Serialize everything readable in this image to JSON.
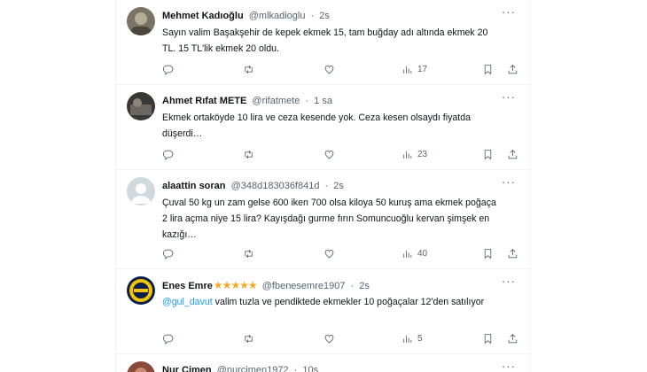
{
  "icons": {
    "more": "more-dots-icon",
    "reply": "reply-icon",
    "retweet": "retweet-icon",
    "like": "heart-icon",
    "views": "views-chart-icon",
    "bookmark": "bookmark-icon",
    "share": "share-icon"
  },
  "colors": {
    "text": "#0f1419",
    "secondary": "#536471",
    "link": "#1d9bf0",
    "star": "#f5a623"
  },
  "more_label": "···",
  "tweets": [
    {
      "name": "Mehmet Kadıoğlu",
      "handle": "@mlkadioglu",
      "sep": "·",
      "time": "2s",
      "text": "Sayın valim Başakşehir de kepek ekmek 15, tam buğday adı altında ekmek 20 TL. 15 TL'lik ekmek 20 oldu.",
      "views": "17"
    },
    {
      "name": "Ahmet Rıfat METE",
      "handle": "@rifatmete",
      "sep": "·",
      "time": "1 sa",
      "text": "Ekmek ortaköyde 10 lira ve ceza kesende yok. Ceza kesen olsaydı fiyatda düşerdi…",
      "views": "23"
    },
    {
      "name": "alaattin soran",
      "handle": "@348d183036f841d",
      "sep": "·",
      "time": "2s",
      "text": "Çuval 50 kg un zam gelse 600 iken 700 olsa kiloya 50 kuruş ama ekmek poğaça 2 lira açma niye 15 lira? Kayışdağı gurme fırın Somuncuoğlu kervan şimşek en kazığı…",
      "views": "40"
    },
    {
      "name": "Enes Emre",
      "stars": "★★★★★",
      "handle": "@fbenesemre1907",
      "sep": "·",
      "time": "2s",
      "mention": "@gul_davut",
      "text": " valim tuzla ve pendiktede ekmekler 10 poğaçalar 12'den satılıyor",
      "views": "5"
    },
    {
      "name": "Nur Cimen",
      "handle": "@nurcimen1972",
      "sep": "·",
      "time": "10s"
    }
  ]
}
